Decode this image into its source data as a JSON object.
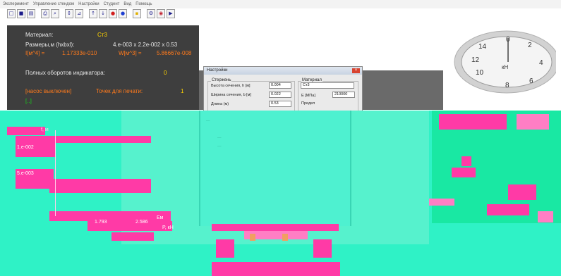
{
  "menu": [
    "Эксперимент",
    "Управление стендом",
    "Настройки",
    "Студент",
    "Вид",
    "Помощь"
  ],
  "toolbar": {
    "buttons": [
      {
        "icon": "new-icon",
        "glyph": "□"
      },
      {
        "icon": "save-icon",
        "glyph": "■"
      },
      {
        "icon": "open-icon",
        "glyph": "▤"
      },
      {
        "icon": "print-icon",
        "glyph": "⎙"
      },
      {
        "icon": "preview-icon",
        "glyph": "⌕"
      },
      {
        "icon": "measure-icon",
        "glyph": "↕"
      },
      {
        "icon": "chart-icon",
        "glyph": "⊿"
      },
      {
        "icon": "arrow-up-icon",
        "glyph": "↑"
      },
      {
        "icon": "arrow-down-icon",
        "glyph": "↓"
      },
      {
        "icon": "record-icon",
        "glyph": "●"
      },
      {
        "icon": "stop-icon",
        "glyph": "●"
      },
      {
        "icon": "flag-icon",
        "glyph": "▪"
      },
      {
        "icon": "settings-icon",
        "glyph": "⚙"
      },
      {
        "icon": "indicator-icon",
        "glyph": "◉"
      },
      {
        "icon": "exit-icon",
        "glyph": "▶"
      }
    ]
  },
  "info": {
    "material_label": "Материал:",
    "material_value": "Ст3",
    "size_label": "Размеры,м (hxbxl):",
    "size_value": "4.e-003 x 2.2e-002 x 0.53",
    "inertia_label": "I[м^4] =",
    "inertia_value": "1.17333e-010",
    "modulus_label": "W[м^3] =",
    "modulus_value": "5.86667e-008",
    "turns_label": "Полных оборотов индикатора:",
    "turns_value": "0",
    "pump_status": "[насос выключен]",
    "print_points_label": "Точек для печати:",
    "print_points_value": "1",
    "bracket": "[..]"
  },
  "gauge": {
    "numbers": [
      "0",
      "2",
      "4",
      "6",
      "8",
      "10",
      "12",
      "14"
    ],
    "unit": "кН"
  },
  "dialog": {
    "title": "Настройки",
    "rod_group": "Стержень",
    "height_label": "Высота сечения, h [м]",
    "height_value": "0.004",
    "width_label": "Ширина сечения, b [м]",
    "width_value": "0.022",
    "length_label": "Длина (м)",
    "length_value": "0.53",
    "material_group": "Материал",
    "material_value": "Ст3",
    "e_label": "E [МПа]",
    "e_value": "210000",
    "limit_label": "Предел"
  },
  "plot": {
    "y1": "1.e-002",
    "y2": "5.e-003",
    "x1": "1.793",
    "x2": "2.586",
    "xunit": "P, кН",
    "yunit": "f, м",
    "xaxis_tag": "Ем"
  },
  "colors": {
    "panel": "#3e3e3e",
    "orange": "#ff7a1c",
    "yellow": "#ffd400",
    "green": "#17d21b",
    "glitch_cyan": "#2ff2c6",
    "glitch_pink": "#ff3aa6"
  }
}
